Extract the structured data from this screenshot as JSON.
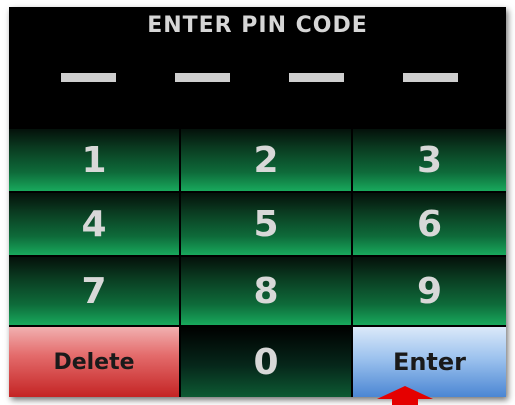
{
  "title": "ENTER PIN CODE",
  "pin": {
    "slot_count": 4,
    "entered_digits": 0
  },
  "keys": {
    "k1": "1",
    "k2": "2",
    "k3": "3",
    "k4": "4",
    "k5": "5",
    "k6": "6",
    "k7": "7",
    "k8": "8",
    "k9": "9",
    "k0": "0",
    "delete": "Delete",
    "enter": "Enter"
  },
  "colors": {
    "key_green": "#0e6b3a",
    "delete_red": "#c42424",
    "enter_blue": "#4b86d3",
    "annotation_arrow": "#e50000"
  },
  "annotation": {
    "icon": "up-arrow-icon",
    "target": "enter"
  }
}
